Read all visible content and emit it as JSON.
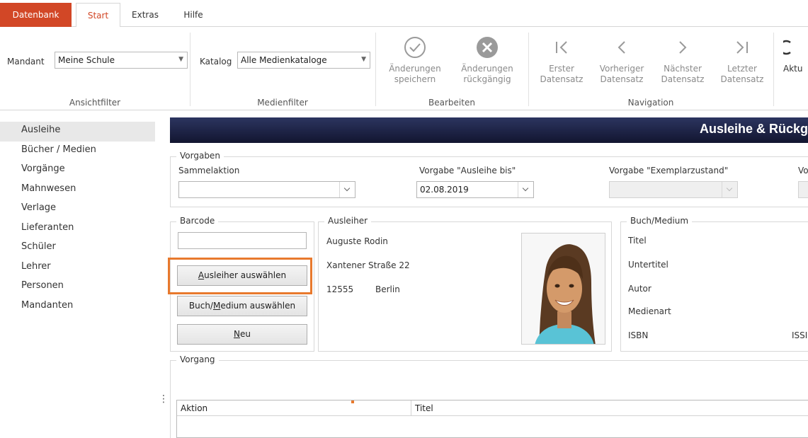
{
  "tabs": {
    "file": "Datenbank",
    "items": [
      "Start",
      "Extras",
      "Hilfe"
    ]
  },
  "ribbon": {
    "ansichtfilter": {
      "label": "Mandant",
      "value": "Meine Schule",
      "group": "Ansichtfilter"
    },
    "medienfilter": {
      "label": "Katalog",
      "value": "Alle Medienkataloge",
      "group": "Medienfilter"
    },
    "bearbeiten": {
      "group": "Bearbeiten",
      "save_line1": "Änderungen",
      "save_line2": "speichern",
      "undo_line1": "Änderungen",
      "undo_line2": "rückgängig"
    },
    "navigation": {
      "group": "Navigation",
      "first_line1": "Erster",
      "first_line2": "Datensatz",
      "prev_line1": "Vorheriger",
      "prev_line2": "Datensatz",
      "next_line1": "Nächster",
      "next_line2": "Datensatz",
      "last_line1": "Letzter",
      "last_line2": "Datensatz"
    },
    "refresh_label": "Aktu"
  },
  "sidebar": {
    "items": [
      {
        "label": "Ausleihe"
      },
      {
        "label": "Bücher / Medien"
      },
      {
        "label": "Vorgänge"
      },
      {
        "label": "Mahnwesen"
      },
      {
        "label": "Verlage"
      },
      {
        "label": "Lieferanten"
      },
      {
        "label": "Schüler"
      },
      {
        "label": "Lehrer"
      },
      {
        "label": "Personen"
      },
      {
        "label": "Mandanten"
      }
    ]
  },
  "main": {
    "title": "Ausleihe & Rückg",
    "vorgaben": {
      "legend": "Vorgaben",
      "sammelaktion_label": "Sammelaktion",
      "sammelaktion_value": "",
      "ausleihe_bis_label": "Vorgabe \"Ausleihe bis\"",
      "ausleihe_bis_value": "02.08.2019",
      "exemplarzustand_label": "Vorgabe \"Exemplarzustand\"",
      "exemplarzustand_value": "",
      "more_label": "Vo"
    },
    "barcode": {
      "legend": "Barcode",
      "value": "",
      "btn_ausleiher": "Ausleiher auswählen",
      "btn_ausleiher_accel": "A",
      "btn_ausleiher_rest": "usleiher auswählen",
      "btn_buch_pre": "Buch/",
      "btn_buch_accel": "M",
      "btn_buch_rest": "edium auswählen",
      "btn_neu_accel": "N",
      "btn_neu_rest": "eu"
    },
    "ausleiher": {
      "legend": "Ausleiher",
      "name": "Auguste Rodin",
      "street": "Xantener Straße 22",
      "zip": "12555",
      "city": "Berlin"
    },
    "buch": {
      "legend": "Buch/Medium",
      "titel": "Titel",
      "untertitel": "Untertitel",
      "autor": "Autor",
      "medienart": "Medienart",
      "isbn": "ISBN",
      "issn": "ISSI"
    },
    "vorgang": {
      "legend": "Vorgang",
      "columns": [
        "Aktion",
        "Titel"
      ]
    }
  }
}
